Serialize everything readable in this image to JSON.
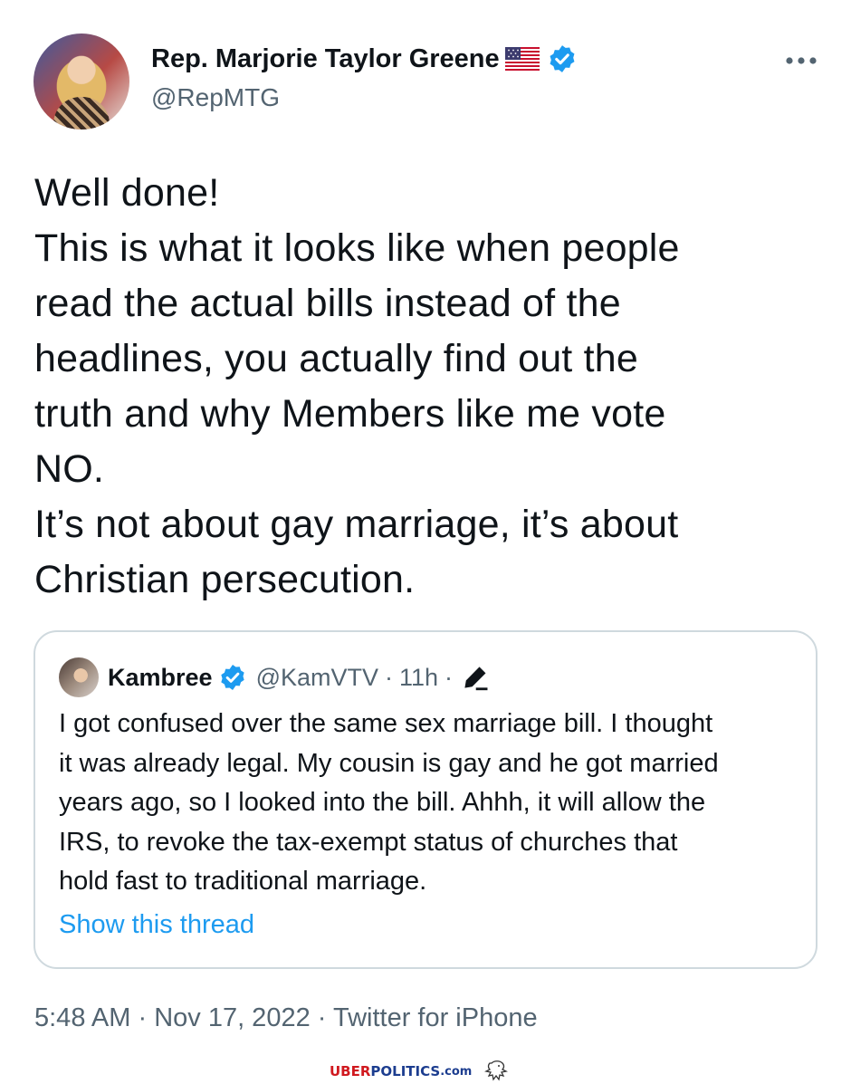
{
  "author": {
    "name": "Rep. Marjorie Taylor Greene",
    "handle": "@RepMTG"
  },
  "tweet": {
    "lines": [
      "Well done!",
      "This is what it looks like when people",
      "read the actual bills instead of the",
      "headlines, you actually find out the",
      "truth and why Members like me vote",
      "NO.",
      "It’s not about gay marriage, it’s about",
      "Christian persecution."
    ]
  },
  "quote": {
    "name": "Kambree",
    "handle": "@KamVTV",
    "sep1": "·",
    "time": "11h",
    "sep2": "·",
    "lines": [
      "I got confused over the same sex marriage bill. I thought",
      "it was already legal. My cousin is gay and he got married",
      "years ago, so I looked into the bill. Ahhh, it will allow the",
      "IRS, to revoke the tax-exempt status of churches that",
      "hold fast to traditional marriage."
    ],
    "show_thread": "Show this thread"
  },
  "footer": {
    "time": "5:48 AM",
    "sep1": " · ",
    "date": "Nov 17, 2022",
    "sep2": " · ",
    "source": "Twitter for iPhone"
  },
  "watermark": {
    "part1": "UBER",
    "part2": "POLITICS",
    "part3": ".com"
  },
  "icons": {
    "verified": "verified-badge-icon",
    "flag": "us-flag-icon",
    "more": "more-dots-icon",
    "edit": "edit-pen-icon",
    "eagle": "eagle-icon"
  },
  "colors": {
    "verified": "#1d9bf0",
    "link": "#1d9bf0",
    "secondary_text": "#536471",
    "border": "#cfd9de",
    "watermark_red": "#d0191f",
    "watermark_blue": "#1c3d8f"
  }
}
